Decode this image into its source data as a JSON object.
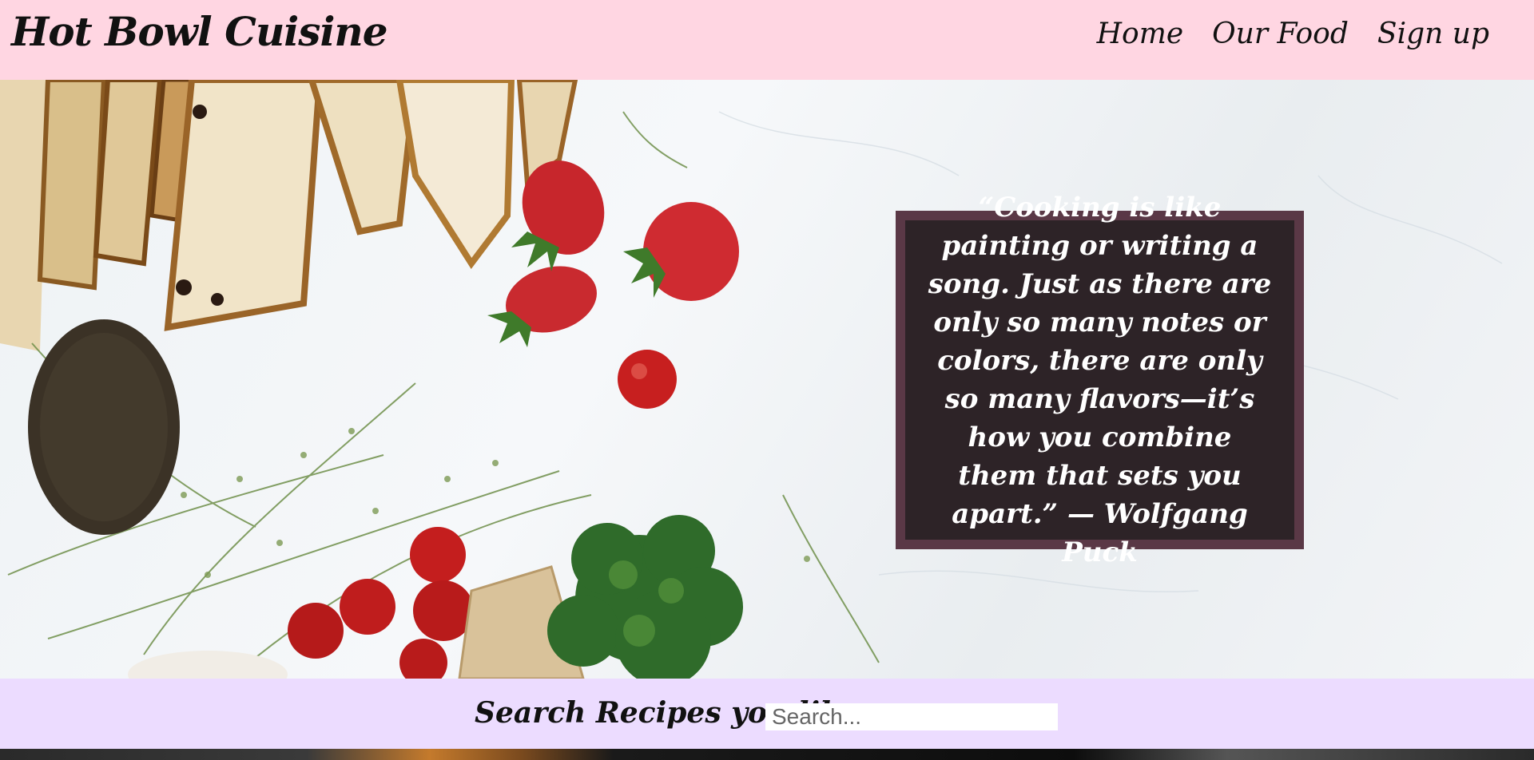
{
  "header": {
    "logo": "Hot Bowl Cuisine",
    "nav": [
      {
        "label": "Home"
      },
      {
        "label": "Our Food"
      },
      {
        "label": "Sign up"
      }
    ]
  },
  "hero": {
    "quote": "“Cooking is like painting or writing a song. Just as there are only so many notes or colors, there are only so many flavors—it’s how you combine them that sets you apart.” — Wolfgang Puck"
  },
  "search": {
    "label": "Search Recipes you like :",
    "placeholder": "Search...",
    "value": ""
  },
  "colors": {
    "header_bg": "#ffd6e2",
    "search_bg": "#ecdcff",
    "quote_bg": "#2d2327",
    "quote_border": "#5a3846"
  }
}
